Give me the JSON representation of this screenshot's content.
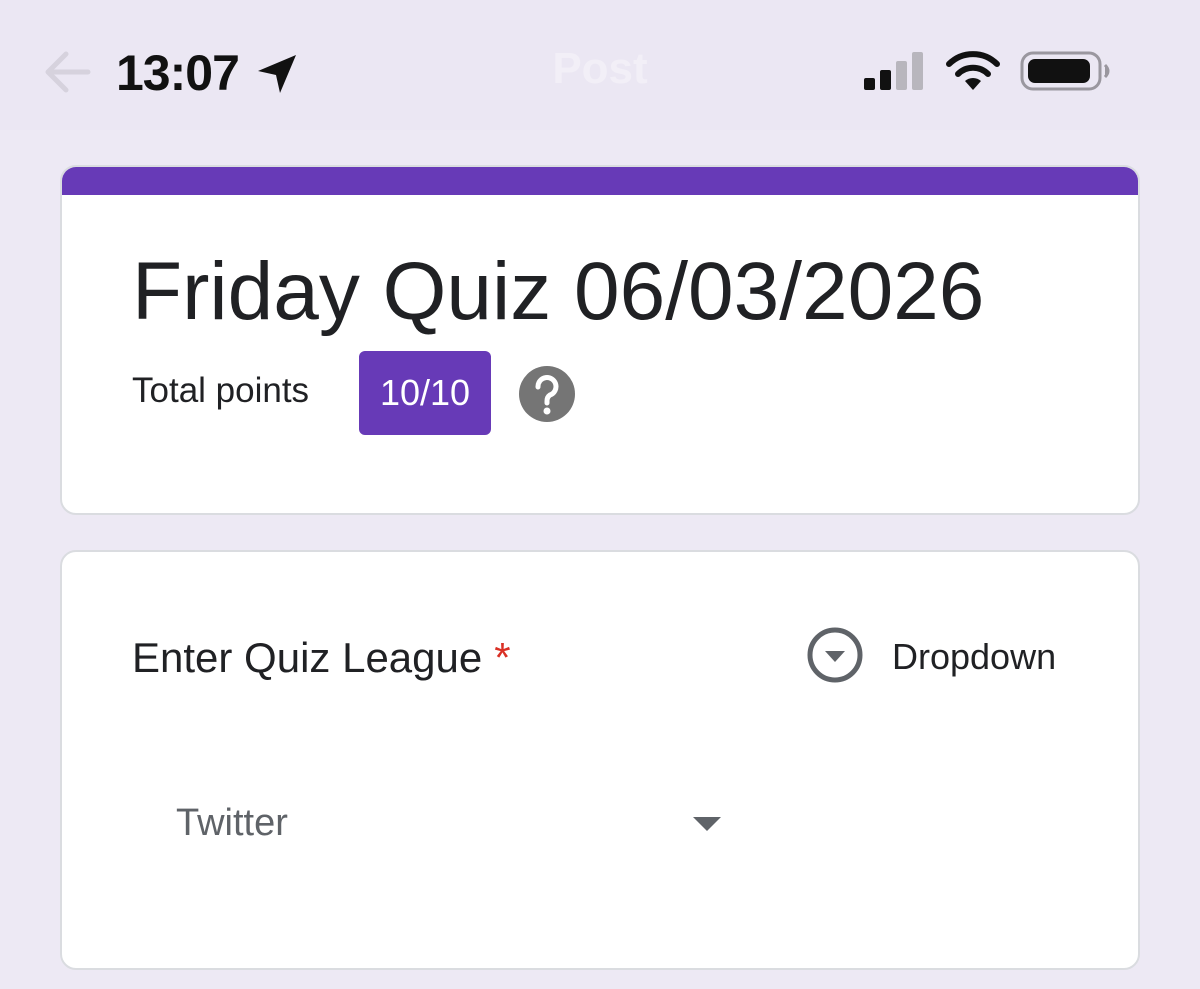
{
  "status_bar": {
    "time": "13:07",
    "nav_title": "Post",
    "icons": [
      "back-arrow-icon",
      "location-arrow-icon",
      "signal-icon",
      "wifi-icon",
      "battery-icon"
    ],
    "signal_bars_active": 2,
    "signal_bars_total": 4,
    "battery_level": 0.8
  },
  "header": {
    "title": "Friday Quiz 06/03/2026",
    "points_label": "Total points",
    "score": "10/10",
    "help_icon": "help-question-icon"
  },
  "question": {
    "title": "Enter Quiz League",
    "required_marker": "*",
    "type_label": "Dropdown",
    "type_icon": "dropdown-circle-icon",
    "selected_value": "Twitter"
  },
  "colors": {
    "accent": "#673ab7",
    "page_background": "#ede9f4",
    "required": "#d93025",
    "text_primary": "#202124",
    "text_secondary": "#5f6368"
  }
}
